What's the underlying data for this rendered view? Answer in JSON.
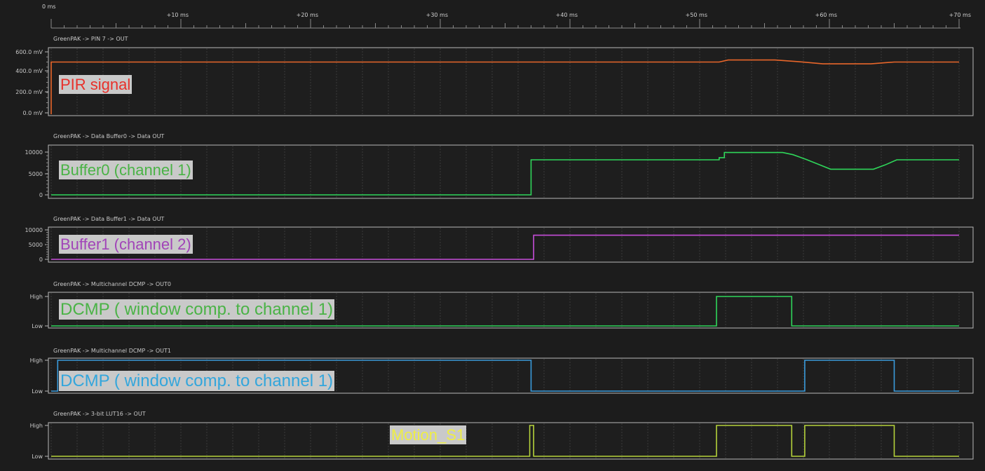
{
  "timeline": {
    "unit": "ms",
    "range": [
      0,
      70
    ],
    "tick_labels": [
      "0 ms",
      "+10 ms",
      "+20 ms",
      "+30 ms",
      "+40 ms",
      "+50 ms",
      "+60 ms",
      "+70 ms"
    ]
  },
  "channels": [
    {
      "id": "pin7",
      "title": "GreenPAK -> PIN 7 -> OUT",
      "type": "analog",
      "color": "#e8662a",
      "y_labels": [
        "600.0 mV",
        "400.0 mV",
        "200.0 mV",
        "0.0 mV"
      ],
      "y_range": [
        0,
        600
      ],
      "annotation": {
        "text": "PIR signal",
        "color": "#e8302a"
      },
      "trace": [
        [
          0,
          -1
        ],
        [
          0,
          500
        ],
        [
          51.5,
          500
        ],
        [
          52.2,
          520
        ],
        [
          55.8,
          520
        ],
        [
          57.5,
          505
        ],
        [
          59.5,
          482
        ],
        [
          63.2,
          482
        ],
        [
          65,
          500
        ],
        [
          70,
          500
        ]
      ]
    },
    {
      "id": "buffer0",
      "title": "GreenPAK -> Data Buffer0 -> Data OUT",
      "type": "analog",
      "color": "#2fd65a",
      "y_labels": [
        "10000",
        "5000",
        "0"
      ],
      "y_range": [
        -400,
        11800
      ],
      "annotation": {
        "text": "Buffer0 (channel 1)",
        "color": "#4ab346"
      },
      "trace": [
        [
          0,
          0
        ],
        [
          37,
          0
        ],
        [
          37,
          8200
        ],
        [
          51.5,
          8200
        ],
        [
          51.5,
          8700
        ],
        [
          51.9,
          8700
        ],
        [
          51.9,
          9900
        ],
        [
          56.4,
          9900
        ],
        [
          57.2,
          9400
        ],
        [
          58.2,
          8300
        ],
        [
          59.2,
          7100
        ],
        [
          60.1,
          6000
        ],
        [
          63.4,
          6000
        ],
        [
          64.3,
          7000
        ],
        [
          65.2,
          8200
        ],
        [
          70,
          8200
        ]
      ]
    },
    {
      "id": "buffer1",
      "title": "GreenPAK -> Data Buffer1 -> Data OUT",
      "type": "analog",
      "color": "#c64dd8",
      "y_labels": [
        "10000",
        "5000",
        "0"
      ],
      "y_range": [
        -400,
        11800
      ],
      "annotation": {
        "text": "Buffer1 (channel 2)",
        "color": "#a144b8"
      },
      "trace": [
        [
          0,
          0
        ],
        [
          37.2,
          0
        ],
        [
          37.2,
          8200
        ],
        [
          70,
          8200
        ]
      ]
    },
    {
      "id": "dcmp0",
      "title": "GreenPAK -> Multichannel DCMP -> OUT0",
      "type": "digital",
      "color": "#2fd65a",
      "y_labels": [
        "High",
        "Low"
      ],
      "annotation": {
        "text": "DCMP ( window comp. to channel 1)",
        "color": "#4ab346"
      },
      "trace": [
        [
          0,
          0
        ],
        [
          51.3,
          0
        ],
        [
          51.3,
          1
        ],
        [
          57.1,
          1
        ],
        [
          57.1,
          0
        ],
        [
          70,
          0
        ]
      ]
    },
    {
      "id": "dcmp1",
      "title": "GreenPAK -> Multichannel DCMP -> OUT1",
      "type": "digital",
      "color": "#3a9bdc",
      "y_labels": [
        "High",
        "Low"
      ],
      "annotation": {
        "text": "DCMP ( window comp. to channel 1)",
        "color": "#33a6dc"
      },
      "trace": [
        [
          0,
          0
        ],
        [
          0.5,
          0
        ],
        [
          0.5,
          1
        ],
        [
          37,
          1
        ],
        [
          37,
          0
        ],
        [
          58.1,
          0
        ],
        [
          58.1,
          1
        ],
        [
          65,
          1
        ],
        [
          65,
          0
        ],
        [
          70,
          0
        ]
      ]
    },
    {
      "id": "lut16",
      "title": "GreenPAK -> 3-bit LUT16 -> OUT",
      "type": "digital",
      "color": "#b5d23b",
      "y_labels": [
        "High",
        "Low"
      ],
      "annotation": {
        "text": "Motion_S1",
        "color": "#eeee44"
      },
      "trace": [
        [
          0,
          0
        ],
        [
          36.9,
          0
        ],
        [
          36.9,
          1
        ],
        [
          37.2,
          1
        ],
        [
          37.2,
          0
        ],
        [
          51.3,
          0
        ],
        [
          51.3,
          1
        ],
        [
          57.1,
          1
        ],
        [
          57.1,
          0
        ],
        [
          58.1,
          0
        ],
        [
          58.1,
          1
        ],
        [
          65,
          1
        ],
        [
          65,
          0
        ],
        [
          70,
          0
        ]
      ]
    }
  ]
}
